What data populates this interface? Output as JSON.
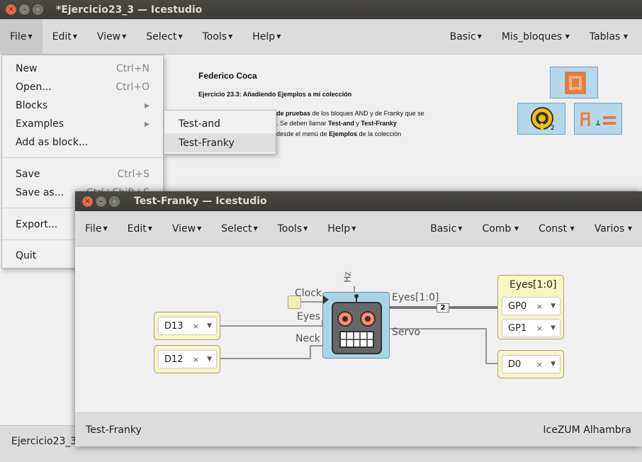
{
  "main_window": {
    "title": "*Ejercicio23_3 — Icestudio",
    "menu_left": [
      "File",
      "Edit",
      "View",
      "Select",
      "Tools",
      "Help"
    ],
    "menu_right": [
      "Basic",
      "Mis_bloques",
      "Tablas"
    ],
    "info": {
      "author": "Federico Coca",
      "heading": "Ejercicio 23.3: Añadiendo Ejemplos a mi colección",
      "line1_bold": "de pruebas",
      "line1_rest": " de los bloques AND y de Franky que se",
      "line2_pre": ". Se deben llamar ",
      "line2_b1": "Test-and",
      "line2_mid": " y ",
      "line2_b2": "Test-Franky",
      "line3_pre": "desde el menú de ",
      "line3_b": "Ejemplos",
      "line3_rest": " de la colección"
    },
    "icons": {
      "icon2_sub": "2"
    },
    "status": "Ejercicio23_3"
  },
  "file_menu": {
    "items": [
      {
        "label": "New",
        "shortcut": "Ctrl+N"
      },
      {
        "label": "Open...",
        "shortcut": "Ctrl+O"
      },
      {
        "label": "Blocks",
        "shortcut": "▸"
      },
      {
        "label": "Examples",
        "shortcut": "▸"
      },
      {
        "label": "Add as block...",
        "shortcut": ""
      },
      {
        "label": "Save",
        "shortcut": "Ctrl+S"
      },
      {
        "label": "Save as...",
        "shortcut": "Ctrl+Shift+S"
      },
      {
        "label": "Export...",
        "shortcut": "▸"
      },
      {
        "label": "Quit",
        "shortcut": ""
      }
    ]
  },
  "examples_submenu": {
    "items": [
      "Test-and",
      "Test-Franky"
    ]
  },
  "child_window": {
    "title": "Test-Franky — Icestudio",
    "menu_left": [
      "File",
      "Edit",
      "View",
      "Select",
      "Tools",
      "Help"
    ],
    "menu_right": [
      "Basic",
      "Comb",
      "Const",
      "Varios"
    ],
    "blocks": {
      "in1_pin": "D13",
      "in2_pin": "D12",
      "eyes_title": "Eyes[1:0]",
      "eyes_pin1": "GP0",
      "eyes_pin2": "GP1",
      "servo_pin": "D0"
    },
    "ports": {
      "clock": "Clock",
      "eyes_in": "Eyes",
      "neck": "Neck",
      "hz": "Hz",
      "eyes_out": "Eyes[1:0]",
      "servo": "Servo",
      "bus_width": "2"
    },
    "status_left": "Test-Franky",
    "status_right": "IceZUM Alhambra"
  },
  "colors": {
    "titlebar": "#3c3b37",
    "close_button": "#df4b16",
    "io_block": "#f7f4c5",
    "robot_block": "#a8d4e6",
    "icon_bg": "#b6d7ea"
  }
}
